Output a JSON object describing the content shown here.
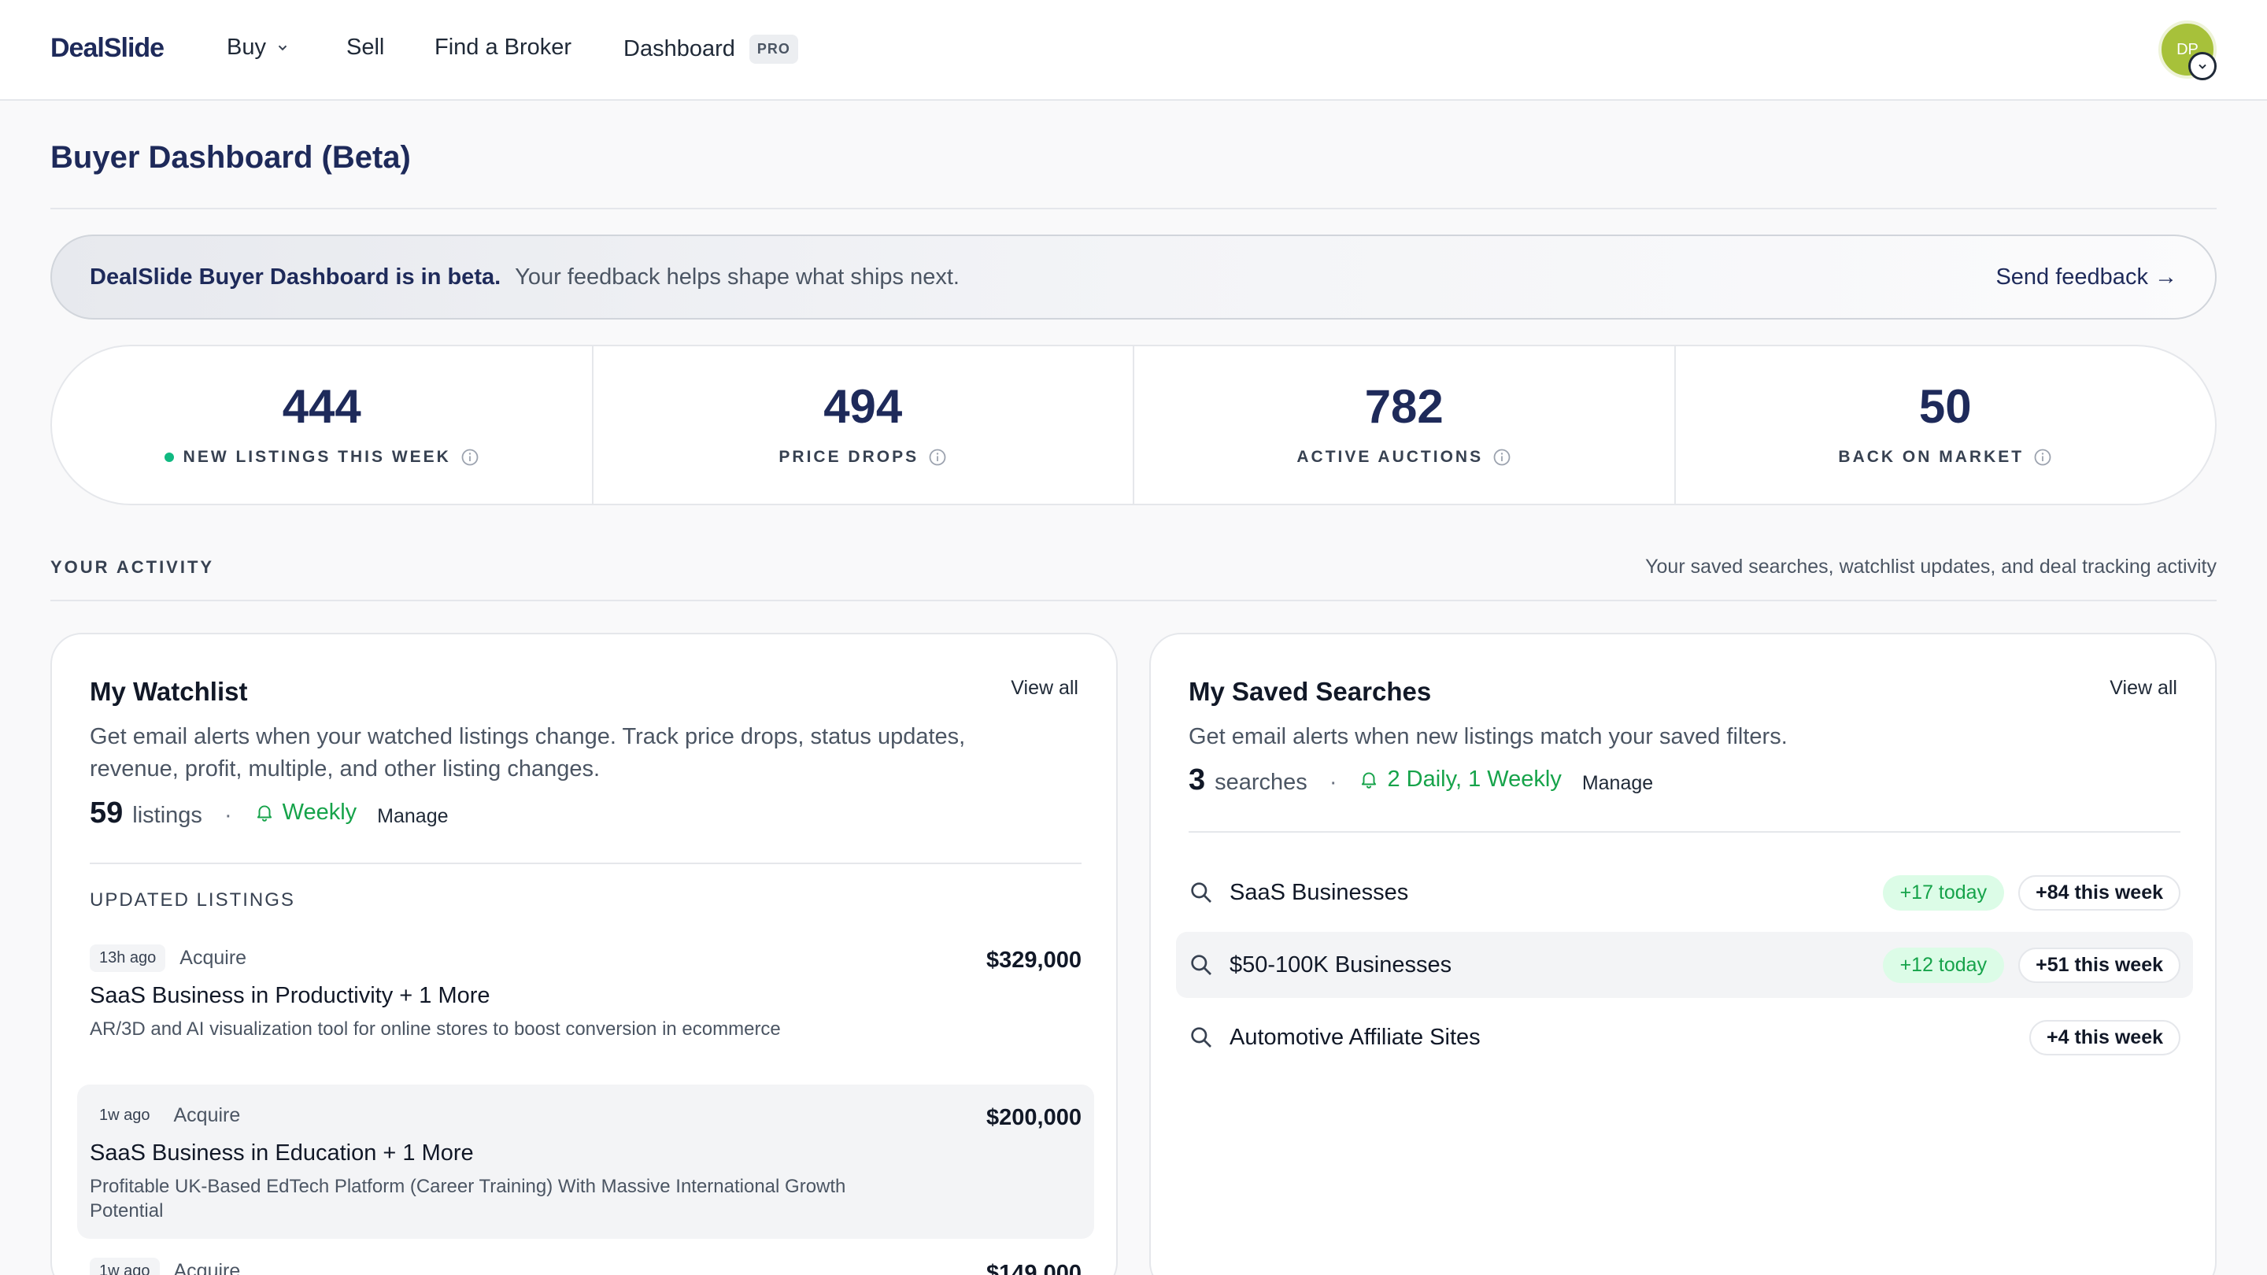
{
  "nav": {
    "logo": "DealSlide",
    "buy": "Buy",
    "sell": "Sell",
    "find_broker": "Find a Broker",
    "dashboard": "Dashboard",
    "pro_badge": "PRO",
    "avatar_initials": "DP"
  },
  "page": {
    "title": "Buyer Dashboard (Beta)"
  },
  "banner": {
    "strong": "DealSlide Buyer Dashboard is in beta.",
    "text": "Your feedback helps shape what ships next.",
    "link": "Send feedback →"
  },
  "stats": [
    {
      "value": "444",
      "label": "NEW LISTINGS THIS WEEK"
    },
    {
      "value": "494",
      "label": "PRICE DROPS"
    },
    {
      "value": "782",
      "label": "ACTIVE AUCTIONS"
    },
    {
      "value": "50",
      "label": "BACK ON MARKET"
    }
  ],
  "activity": {
    "label": "YOUR ACTIVITY",
    "description": "Your saved searches, watchlist updates, and deal tracking activity"
  },
  "watchlist": {
    "title": "My Watchlist",
    "view_all": "View all",
    "description": "Get email alerts when your watched listings change. Track price drops, status updates, revenue, profit, multiple, and other listing changes.",
    "count": "59",
    "unit": "listings",
    "frequency": "Weekly",
    "manage": "Manage",
    "section_label": "UPDATED LISTINGS",
    "listings": [
      {
        "age": "13h ago",
        "source": "Acquire",
        "price": "$329,000",
        "title": "SaaS Business in Productivity + 1 More",
        "description": "AR/3D and AI visualization tool for online stores to boost conversion in ecommerce"
      },
      {
        "age": "1w ago",
        "source": "Acquire",
        "price": "$200,000",
        "title": "SaaS Business in Education + 1 More",
        "description": "Profitable UK-Based EdTech Platform (Career Training) With Massive International Growth Potential"
      },
      {
        "age": "1w ago",
        "source": "Acquire",
        "price": "$149,000",
        "title": "",
        "description": ""
      }
    ]
  },
  "saved_searches": {
    "title": "My Saved Searches",
    "view_all": "View all",
    "description": "Get email alerts when new listings match your saved filters.",
    "count": "3",
    "unit": "searches",
    "frequency": "2 Daily, 1 Weekly",
    "manage": "Manage",
    "items": [
      {
        "name": "SaaS Businesses",
        "today": "+17 today",
        "week": "+84 this week"
      },
      {
        "name": "$50-100K Businesses",
        "today": "+12 today",
        "week": "+51 this week"
      },
      {
        "name": "Automotive Affiliate Sites",
        "today": "",
        "week": "+4 this week"
      }
    ]
  },
  "colors": {
    "brand_navy": "#1e2a5a",
    "accent_green": "#16a34a",
    "live_dot": "#10b981",
    "avatar": "#a7c13a"
  }
}
